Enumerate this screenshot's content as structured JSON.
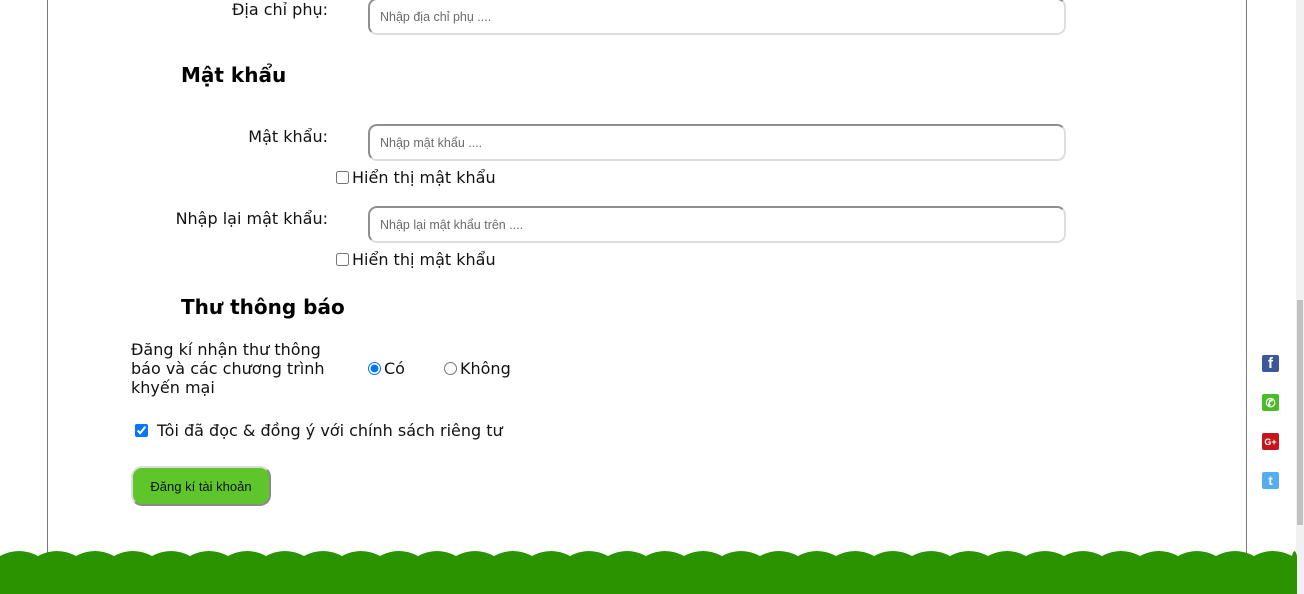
{
  "address": {
    "secondary_label": "Địa chỉ phụ:",
    "secondary_placeholder": "Nhập địa chỉ phụ ...."
  },
  "password_section": {
    "title": "Mật khẩu",
    "password_label": "Mật khẩu:",
    "password_placeholder": "Nhập mật khẩu ....",
    "show_password_1": "Hiển thị mật khẩu",
    "confirm_label": "Nhập lại mật khẩu:",
    "confirm_placeholder": "Nhập lại mật khẩu trên ....",
    "show_password_2": "Hiển thị mật khẩu"
  },
  "newsletter_section": {
    "title": "Thư thông báo",
    "subscribe_label_line1": "Đăng kí nhận thư thông",
    "subscribe_label_line2": "báo và các chương trình",
    "subscribe_label_line3": "khyến mại",
    "option_yes": "Có",
    "option_no": "Không",
    "selected": "Có"
  },
  "privacy": {
    "agree_label": "Tôi đã đọc & đồng ý với chính sách riêng tư",
    "checked": true
  },
  "submit_label": "Đăng kí tài khoản",
  "social": {
    "items": [
      {
        "name": "facebook",
        "glyph": "f",
        "color": "#3b5998"
      },
      {
        "name": "phone",
        "glyph": "✆",
        "color": "#4cbb2a"
      },
      {
        "name": "google-plus",
        "glyph": "G+",
        "color": "#c4161c"
      },
      {
        "name": "twitter",
        "glyph": "t",
        "color": "#55acee"
      }
    ]
  },
  "colors": {
    "button_green": "#5ec52b",
    "footer_green": "#2a9400"
  }
}
